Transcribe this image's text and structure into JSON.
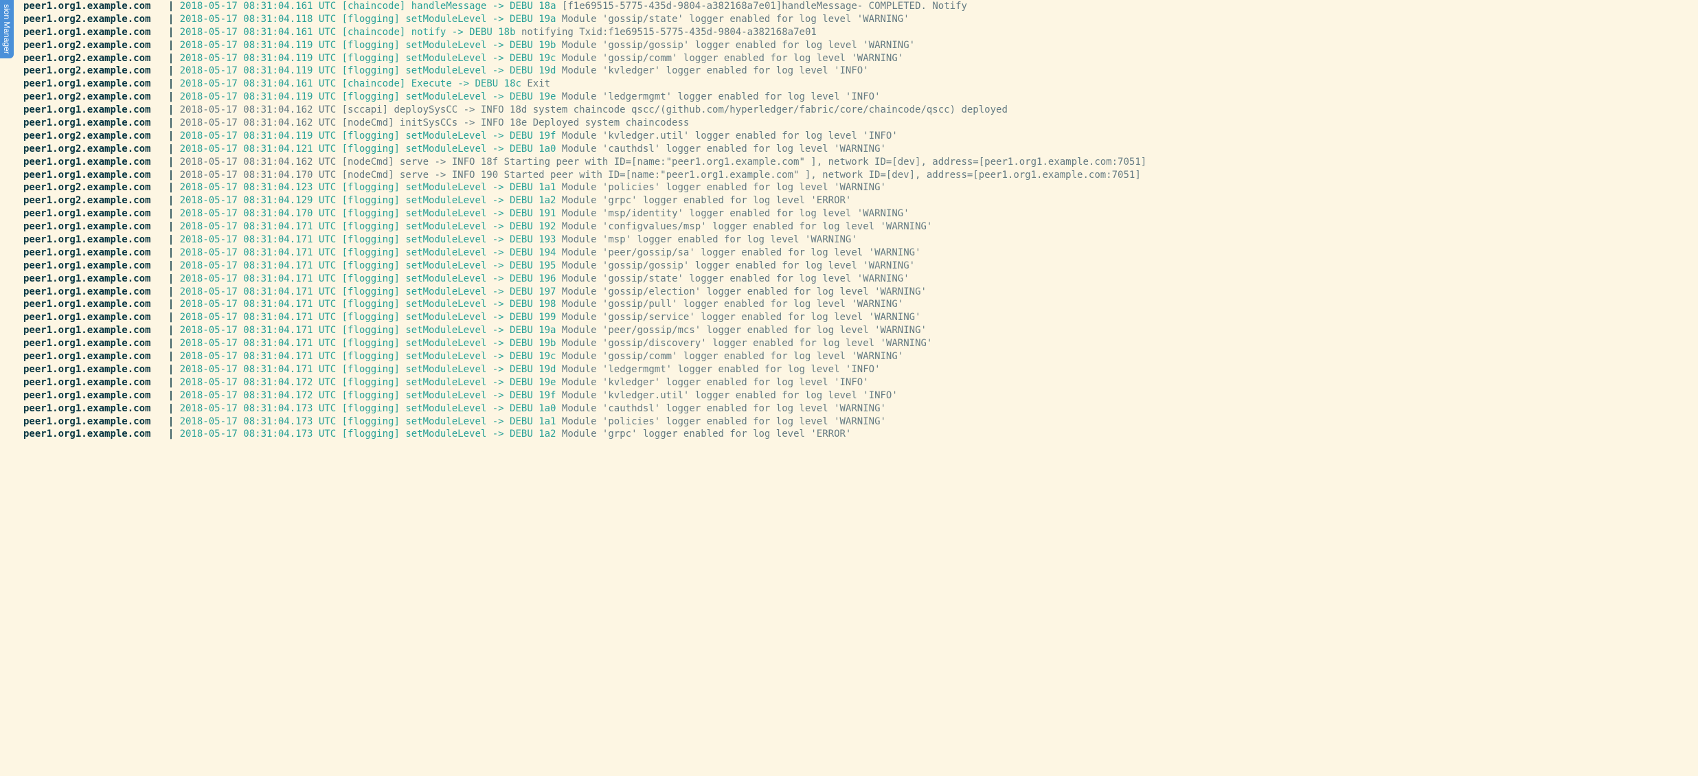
{
  "sidebar_tab": "sion Manager",
  "lines": [
    {
      "src": "peer1.org1.example.com",
      "ts": "2018-05-17 08:31:04.161 UTC",
      "mod": "[chaincode]",
      "fn": "handleMessage",
      "lvl": "DEBU",
      "id": "18a",
      "msg": "[f1e69515-5775-435d-9804-a382168a7e01]handleMessage- COMPLETED. Notify"
    },
    {
      "src": "peer1.org2.example.com",
      "ts": "2018-05-17 08:31:04.118 UTC",
      "mod": "[flogging]",
      "fn": "setModuleLevel",
      "lvl": "DEBU",
      "id": "19a",
      "msg": "Module 'gossip/state' logger enabled for log level 'WARNING'"
    },
    {
      "src": "peer1.org1.example.com",
      "ts": "2018-05-17 08:31:04.161 UTC",
      "mod": "[chaincode]",
      "fn": "notify",
      "lvl": "DEBU",
      "id": "18b",
      "msg": "notifying Txid:f1e69515-5775-435d-9804-a382168a7e01"
    },
    {
      "src": "peer1.org2.example.com",
      "ts": "2018-05-17 08:31:04.119 UTC",
      "mod": "[flogging]",
      "fn": "setModuleLevel",
      "lvl": "DEBU",
      "id": "19b",
      "msg": "Module 'gossip/gossip' logger enabled for log level 'WARNING'"
    },
    {
      "src": "peer1.org2.example.com",
      "ts": "2018-05-17 08:31:04.119 UTC",
      "mod": "[flogging]",
      "fn": "setModuleLevel",
      "lvl": "DEBU",
      "id": "19c",
      "msg": "Module 'gossip/comm' logger enabled for log level 'WARNING'"
    },
    {
      "src": "peer1.org2.example.com",
      "ts": "2018-05-17 08:31:04.119 UTC",
      "mod": "[flogging]",
      "fn": "setModuleLevel",
      "lvl": "DEBU",
      "id": "19d",
      "msg": "Module 'kvledger' logger enabled for log level 'INFO'"
    },
    {
      "src": "peer1.org1.example.com",
      "ts": "2018-05-17 08:31:04.161 UTC",
      "mod": "[chaincode]",
      "fn": "Execute",
      "lvl": "DEBU",
      "id": "18c",
      "msg": "Exit"
    },
    {
      "src": "peer1.org2.example.com",
      "ts": "2018-05-17 08:31:04.119 UTC",
      "mod": "[flogging]",
      "fn": "setModuleLevel",
      "lvl": "DEBU",
      "id": "19e",
      "msg": "Module 'ledgermgmt' logger enabled for log level 'INFO'"
    },
    {
      "src": "peer1.org1.example.com",
      "ts": "2018-05-17 08:31:04.162 UTC",
      "mod": "[sccapi]",
      "fn": "deploySysCC",
      "lvl": "INFO",
      "id": "18d",
      "msg": "system chaincode qscc/(github.com/hyperledger/fabric/core/chaincode/qscc) deployed",
      "plain": true
    },
    {
      "src": "peer1.org1.example.com",
      "ts": "2018-05-17 08:31:04.162 UTC",
      "mod": "[nodeCmd]",
      "fn": "initSysCCs",
      "lvl": "INFO",
      "id": "18e",
      "msg": "Deployed system chaincodess",
      "plain": true
    },
    {
      "src": "peer1.org2.example.com",
      "ts": "2018-05-17 08:31:04.119 UTC",
      "mod": "[flogging]",
      "fn": "setModuleLevel",
      "lvl": "DEBU",
      "id": "19f",
      "msg": "Module 'kvledger.util' logger enabled for log level 'INFO'"
    },
    {
      "src": "peer1.org2.example.com",
      "ts": "2018-05-17 08:31:04.121 UTC",
      "mod": "[flogging]",
      "fn": "setModuleLevel",
      "lvl": "DEBU",
      "id": "1a0",
      "msg": "Module 'cauthdsl' logger enabled for log level 'WARNING'"
    },
    {
      "src": "peer1.org1.example.com",
      "ts": "2018-05-17 08:31:04.162 UTC",
      "mod": "[nodeCmd]",
      "fn": "serve",
      "lvl": "INFO",
      "id": "18f",
      "msg": "Starting peer with ID=[name:\"peer1.org1.example.com\" ], network ID=[dev], address=[peer1.org1.example.com:7051]",
      "plain": true
    },
    {
      "src": "peer1.org1.example.com",
      "ts": "2018-05-17 08:31:04.170 UTC",
      "mod": "[nodeCmd]",
      "fn": "serve",
      "lvl": "INFO",
      "id": "190",
      "msg": "Started peer with ID=[name:\"peer1.org1.example.com\" ], network ID=[dev], address=[peer1.org1.example.com:7051]",
      "plain": true,
      "bold": true
    },
    {
      "src": "peer1.org2.example.com",
      "ts": "2018-05-17 08:31:04.123 UTC",
      "mod": "[flogging]",
      "fn": "setModuleLevel",
      "lvl": "DEBU",
      "id": "1a1",
      "msg": "Module 'policies' logger enabled for log level 'WARNING'"
    },
    {
      "src": "peer1.org2.example.com",
      "ts": "2018-05-17 08:31:04.129 UTC",
      "mod": "[flogging]",
      "fn": "setModuleLevel",
      "lvl": "DEBU",
      "id": "1a2",
      "msg": "Module 'grpc' logger enabled for log level 'ERROR'"
    },
    {
      "src": "peer1.org1.example.com",
      "ts": "2018-05-17 08:31:04.170 UTC",
      "mod": "[flogging]",
      "fn": "setModuleLevel",
      "lvl": "DEBU",
      "id": "191",
      "msg": "Module 'msp/identity' logger enabled for log level 'WARNING'"
    },
    {
      "src": "peer1.org1.example.com",
      "ts": "2018-05-17 08:31:04.171 UTC",
      "mod": "[flogging]",
      "fn": "setModuleLevel",
      "lvl": "DEBU",
      "id": "192",
      "msg": "Module 'configvalues/msp' logger enabled for log level 'WARNING'"
    },
    {
      "src": "peer1.org1.example.com",
      "ts": "2018-05-17 08:31:04.171 UTC",
      "mod": "[flogging]",
      "fn": "setModuleLevel",
      "lvl": "DEBU",
      "id": "193",
      "msg": "Module 'msp' logger enabled for log level 'WARNING'"
    },
    {
      "src": "peer1.org1.example.com",
      "ts": "2018-05-17 08:31:04.171 UTC",
      "mod": "[flogging]",
      "fn": "setModuleLevel",
      "lvl": "DEBU",
      "id": "194",
      "msg": "Module 'peer/gossip/sa' logger enabled for log level 'WARNING'"
    },
    {
      "src": "peer1.org1.example.com",
      "ts": "2018-05-17 08:31:04.171 UTC",
      "mod": "[flogging]",
      "fn": "setModuleLevel",
      "lvl": "DEBU",
      "id": "195",
      "msg": "Module 'gossip/gossip' logger enabled for log level 'WARNING'"
    },
    {
      "src": "peer1.org1.example.com",
      "ts": "2018-05-17 08:31:04.171 UTC",
      "mod": "[flogging]",
      "fn": "setModuleLevel",
      "lvl": "DEBU",
      "id": "196",
      "msg": "Module 'gossip/state' logger enabled for log level 'WARNING'"
    },
    {
      "src": "peer1.org1.example.com",
      "ts": "2018-05-17 08:31:04.171 UTC",
      "mod": "[flogging]",
      "fn": "setModuleLevel",
      "lvl": "DEBU",
      "id": "197",
      "msg": "Module 'gossip/election' logger enabled for log level 'WARNING'"
    },
    {
      "src": "peer1.org1.example.com",
      "ts": "2018-05-17 08:31:04.171 UTC",
      "mod": "[flogging]",
      "fn": "setModuleLevel",
      "lvl": "DEBU",
      "id": "198",
      "msg": "Module 'gossip/pull' logger enabled for log level 'WARNING'"
    },
    {
      "src": "peer1.org1.example.com",
      "ts": "2018-05-17 08:31:04.171 UTC",
      "mod": "[flogging]",
      "fn": "setModuleLevel",
      "lvl": "DEBU",
      "id": "199",
      "msg": "Module 'gossip/service' logger enabled for log level 'WARNING'"
    },
    {
      "src": "peer1.org1.example.com",
      "ts": "2018-05-17 08:31:04.171 UTC",
      "mod": "[flogging]",
      "fn": "setModuleLevel",
      "lvl": "DEBU",
      "id": "19a",
      "msg": "Module 'peer/gossip/mcs' logger enabled for log level 'WARNING'"
    },
    {
      "src": "peer1.org1.example.com",
      "ts": "2018-05-17 08:31:04.171 UTC",
      "mod": "[flogging]",
      "fn": "setModuleLevel",
      "lvl": "DEBU",
      "id": "19b",
      "msg": "Module 'gossip/discovery' logger enabled for log level 'WARNING'"
    },
    {
      "src": "peer1.org1.example.com",
      "ts": "2018-05-17 08:31:04.171 UTC",
      "mod": "[flogging]",
      "fn": "setModuleLevel",
      "lvl": "DEBU",
      "id": "19c",
      "msg": "Module 'gossip/comm' logger enabled for log level 'WARNING'"
    },
    {
      "src": "peer1.org1.example.com",
      "ts": "2018-05-17 08:31:04.171 UTC",
      "mod": "[flogging]",
      "fn": "setModuleLevel",
      "lvl": "DEBU",
      "id": "19d",
      "msg": "Module 'ledgermgmt' logger enabled for log level 'INFO'"
    },
    {
      "src": "peer1.org1.example.com",
      "ts": "2018-05-17 08:31:04.172 UTC",
      "mod": "[flogging]",
      "fn": "setModuleLevel",
      "lvl": "DEBU",
      "id": "19e",
      "msg": "Module 'kvledger' logger enabled for log level 'INFO'"
    },
    {
      "src": "peer1.org1.example.com",
      "ts": "2018-05-17 08:31:04.172 UTC",
      "mod": "[flogging]",
      "fn": "setModuleLevel",
      "lvl": "DEBU",
      "id": "19f",
      "msg": "Module 'kvledger.util' logger enabled for log level 'INFO'"
    },
    {
      "src": "peer1.org1.example.com",
      "ts": "2018-05-17 08:31:04.173 UTC",
      "mod": "[flogging]",
      "fn": "setModuleLevel",
      "lvl": "DEBU",
      "id": "1a0",
      "msg": "Module 'cauthdsl' logger enabled for log level 'WARNING'"
    },
    {
      "src": "peer1.org1.example.com",
      "ts": "2018-05-17 08:31:04.173 UTC",
      "mod": "[flogging]",
      "fn": "setModuleLevel",
      "lvl": "DEBU",
      "id": "1a1",
      "msg": "Module 'policies' logger enabled for log level 'WARNING'"
    },
    {
      "src": "peer1.org1.example.com",
      "ts": "2018-05-17 08:31:04.173 UTC",
      "mod": "[flogging]",
      "fn": "setModuleLevel",
      "lvl": "DEBU",
      "id": "1a2",
      "msg": "Module 'grpc' logger enabled for log level 'ERROR'"
    }
  ]
}
